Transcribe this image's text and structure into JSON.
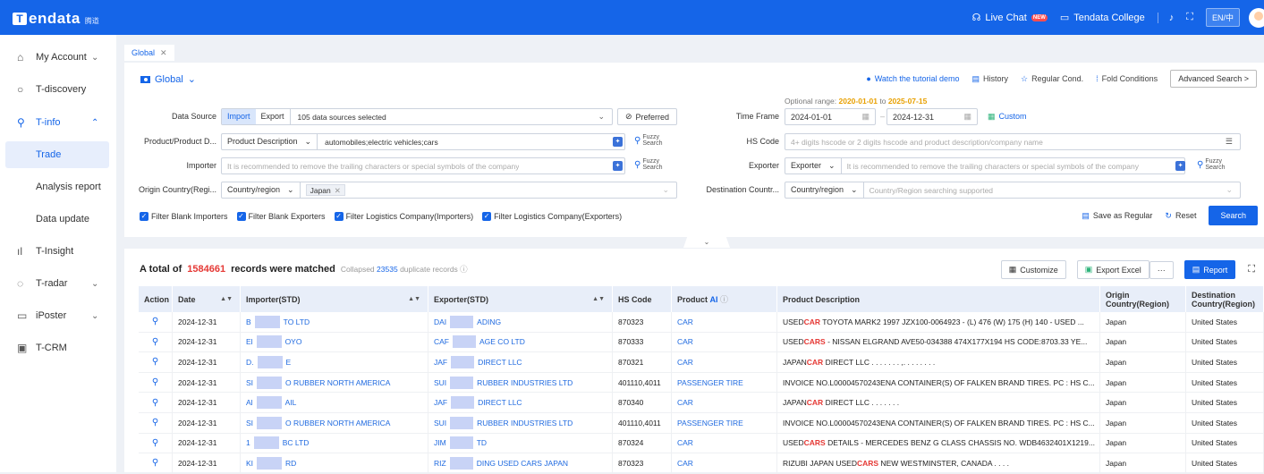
{
  "header": {
    "logo_text": "Tendata",
    "logo_cn": "腾道",
    "live_chat": "Live Chat",
    "new_badge": "NEW",
    "college": "Tendata College",
    "lang": "EN/中"
  },
  "sidebar": {
    "items": [
      {
        "label": "My Account",
        "icon": "home-icon"
      },
      {
        "label": "T-discovery",
        "icon": "circle-icon"
      },
      {
        "label": "T-info",
        "icon": "search-icon"
      },
      {
        "label": "Trade"
      },
      {
        "label": "Analysis report"
      },
      {
        "label": "Data update"
      },
      {
        "label": "T-Insight",
        "icon": "chart-icon"
      },
      {
        "label": "T-radar",
        "icon": "radar-icon"
      },
      {
        "label": "iPoster",
        "icon": "poster-icon"
      },
      {
        "label": "T-CRM",
        "icon": "crm-icon"
      }
    ]
  },
  "tab": {
    "label": "Global"
  },
  "panel": {
    "title": "Global",
    "watch": "Watch the tutorial demo",
    "history": "History",
    "regular": "Regular Cond.",
    "fold": "Fold Conditions",
    "advanced": "Advanced Search >",
    "data_source_label": "Data Source",
    "import": "Import",
    "export": "Export",
    "sources_selected": "105 data sources selected",
    "preferred": "Preferred",
    "product_label": "Product/Product D...",
    "product_type": "Product Description",
    "product_value": "automobiles;electric vehicles;cars",
    "fuzzy1": "Fuzzy",
    "fuzzy2": "Search",
    "importer_label": "Importer",
    "importer_ph": "It is recommended to remove the trailing characters or special symbols of the company",
    "origin_label": "Origin Country(Regi...",
    "origin_type": "Country/region",
    "origin_tag": "Japan",
    "opt_range_prefix": "Optional range:",
    "opt_from": "2020-01-01",
    "opt_to_word": "to",
    "opt_to": "2025-07-15",
    "time_label": "Time Frame",
    "date_from": "2024-01-01",
    "date_to": "2024-12-31",
    "custom": "Custom",
    "hs_label": "HS Code",
    "hs_ph": "4+ digits hscode or 2 digits hscode and product description/company name",
    "exporter_label": "Exporter",
    "exporter_type": "Exporter",
    "exporter_ph": "It is recommended to remove the trailing characters or special symbols of the company",
    "dest_label": "Destination Countr...",
    "dest_type": "Country/region",
    "dest_ph": "Country/Region searching supported",
    "filters": [
      "Filter Blank Importers",
      "Filter Blank Exporters",
      "Filter Logistics Company(Importers)",
      "Filter Logistics Company(Exporters)"
    ],
    "save_regular": "Save as Regular",
    "reset": "Reset",
    "search": "Search"
  },
  "results": {
    "total_prefix": "A total of",
    "total": "1584661",
    "total_suffix": "records were matched",
    "collapsed": "Collapsed",
    "dup_count": "23535",
    "dup_suffix": "duplicate records",
    "customize": "Customize",
    "export_excel": "Export Excel",
    "more": "···",
    "report": "Report",
    "columns": [
      "Action",
      "Date",
      "Importer(STD)",
      "Exporter(STD)",
      "HS Code",
      "Product",
      "AI",
      "Product Description",
      "Origin Country(Region)",
      "Destination Country(Region)"
    ],
    "rows": [
      {
        "date": "2024-12-31",
        "imp_a": "B",
        "imp_b": "TO LTD",
        "exp_a": "DAI",
        "exp_b": "ADING",
        "hs": "870323",
        "product": "CAR",
        "d1": "USED ",
        "d2": "CAR",
        "d3": " TOYOTA MARK2 1997 JZX100-0064923 - (L) 476 (W) 175 (H) 140 - USED ...",
        "origin": "Japan",
        "dest": "United States"
      },
      {
        "date": "2024-12-31",
        "imp_a": "El",
        "imp_b": "OYO",
        "exp_a": "CAF",
        "exp_b": "AGE CO LTD",
        "hs": "870333",
        "product": "CAR",
        "d1": "USED ",
        "d2": "CARS",
        "d3": " - NISSAN ELGRAND AVE50-034388 474X177X194 HS CODE:8703.33 YE...",
        "origin": "Japan",
        "dest": "United States"
      },
      {
        "date": "2024-12-31",
        "imp_a": "D.",
        "imp_b": "E",
        "exp_a": "JAF",
        "exp_b": "DIRECT LLC",
        "hs": "870321",
        "product": "CAR",
        "d1": "JAPAN ",
        "d2": "CAR",
        "d3": " DIRECT LLC . . . . . . . ,. . . . . . . .",
        "origin": "Japan",
        "dest": "United States"
      },
      {
        "date": "2024-12-31",
        "imp_a": "SI",
        "imp_b": "O RUBBER NORTH AMERICA",
        "exp_a": "SUI",
        "exp_b": "RUBBER INDUSTRIES LTD",
        "hs": "401110,4011",
        "product": "PASSENGER TIRE",
        "d1": "INVOICE NO.L00004570243ENA CONTAINER(S) OF FALKEN BRAND TIRES. PC : HS C...",
        "d2": "",
        "d3": "",
        "origin": "Japan",
        "dest": "United States"
      },
      {
        "date": "2024-12-31",
        "imp_a": "Al",
        "imp_b": "AIL",
        "exp_a": "JAF",
        "exp_b": "DIRECT LLC",
        "hs": "870340",
        "product": "CAR",
        "d1": "JAPAN ",
        "d2": "CAR",
        "d3": " DIRECT LLC . . . . . . .",
        "origin": "Japan",
        "dest": "United States"
      },
      {
        "date": "2024-12-31",
        "imp_a": "SI",
        "imp_b": "O RUBBER NORTH AMERICA",
        "exp_a": "SUI",
        "exp_b": "RUBBER INDUSTRIES LTD",
        "hs": "401110,4011",
        "product": "PASSENGER TIRE",
        "d1": "INVOICE NO.L00004570243ENA CONTAINER(S) OF FALKEN BRAND TIRES. PC : HS C...",
        "d2": "",
        "d3": "",
        "origin": "Japan",
        "dest": "United States"
      },
      {
        "date": "2024-12-31",
        "imp_a": "1",
        "imp_b": "BC LTD",
        "exp_a": "JIM",
        "exp_b": "TD",
        "hs": "870324",
        "product": "CAR",
        "d1": "USED ",
        "d2": "CARS",
        "d3": " DETAILS - MERCEDES BENZ G CLASS CHASSIS NO. WDB4632401X1219...",
        "origin": "Japan",
        "dest": "United States"
      },
      {
        "date": "2024-12-31",
        "imp_a": "KI",
        "imp_b": "RD",
        "exp_a": "RIZ",
        "exp_b": "DING USED CARS JAPAN",
        "hs": "870323",
        "product": "CAR",
        "d1": "RIZUBI JAPAN USED ",
        "d2": "CARS",
        "d3": " NEW WESTMINSTER, CANADA . . . .",
        "origin": "Japan",
        "dest": "United States"
      }
    ]
  }
}
